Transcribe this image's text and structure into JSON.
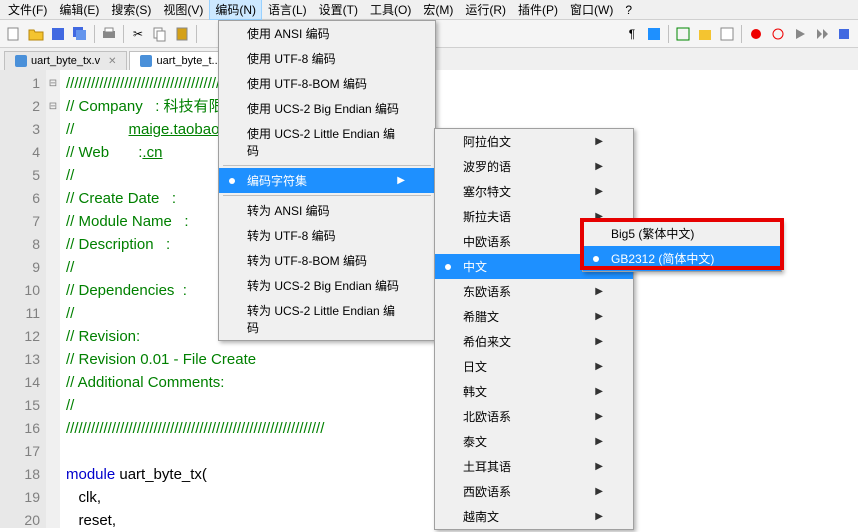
{
  "menubar": [
    "文件(F)",
    "编辑(E)",
    "搜索(S)",
    "视图(V)",
    "编码(N)",
    "语言(L)",
    "设置(T)",
    "工具(O)",
    "宏(M)",
    "运行(R)",
    "插件(P)",
    "窗口(W)",
    "?"
  ],
  "menubar_active_index": 4,
  "tabs": [
    {
      "label": "uart_byte_tx.v",
      "active": false
    },
    {
      "label": "uart_byte_t...",
      "active": true
    }
  ],
  "gutter_lines": [
    "1",
    "2",
    "3",
    "4",
    "5",
    "6",
    "7",
    "8",
    "9",
    "10",
    "11",
    "12",
    "13",
    "14",
    "15",
    "16",
    "17",
    "18",
    "19",
    "20"
  ],
  "code_lines": [
    {
      "cmt": "//////////////////////////////////////////////////////////////"
    },
    {
      "cmt_prefix": "// Company   : ",
      "plain": "科技有限公司"
    },
    {
      "cmt": "//             ",
      "url": "maige.taobao.com"
    },
    {
      "cmt_prefix": "// Web       :",
      "url": ".cn"
    },
    {
      "cmt": "// "
    },
    {
      "cmt": "// Create Date   : "
    },
    {
      "cmt": "// Module Name   : "
    },
    {
      "cmt": "// Description   : "
    },
    {
      "cmt": "// "
    },
    {
      "cmt": "// Dependencies  : "
    },
    {
      "cmt": "// "
    },
    {
      "cmt": "// Revision:"
    },
    {
      "cmt": "// Revision 0.01 - File Create"
    },
    {
      "cmt": "// Additional Comments:"
    },
    {
      "cmt": "// "
    },
    {
      "cmt": "//////////////////////////////////////////////////////////////"
    },
    {
      "plain": ""
    },
    {
      "kw": "module",
      "rest": " uart_byte_tx("
    },
    {
      "plain": "   clk,"
    },
    {
      "plain": "   reset,"
    }
  ],
  "fold_marks": {
    "1": "⊟",
    "18": "⊟"
  },
  "menu_encoding": {
    "items_top": [
      "使用 ANSI 编码",
      "使用 UTF-8 编码",
      "使用 UTF-8-BOM 编码",
      "使用 UCS-2 Big Endian 编码",
      "使用 UCS-2 Little Endian 编码"
    ],
    "charset": "编码字符集",
    "items_bottom": [
      "转为 ANSI 编码",
      "转为 UTF-8 编码",
      "转为 UTF-8-BOM 编码",
      "转为 UCS-2 Big Endian 编码",
      "转为 UCS-2 Little Endian 编码"
    ]
  },
  "submenu_charset": [
    "阿拉伯文",
    "波罗的语",
    "塞尔特文",
    "斯拉夫语",
    "中欧语系",
    "中文",
    "东欧语系",
    "希腊文",
    "希伯来文",
    "日文",
    "韩文",
    "北欧语系",
    "泰文",
    "土耳其语",
    "西欧语系",
    "越南文"
  ],
  "submenu_charset_highlight_index": 5,
  "submenu_chinese": [
    {
      "label": "Big5 (繁体中文)"
    },
    {
      "label": "GB2312 (简体中文)",
      "highlight": true,
      "bullet": true
    }
  ]
}
